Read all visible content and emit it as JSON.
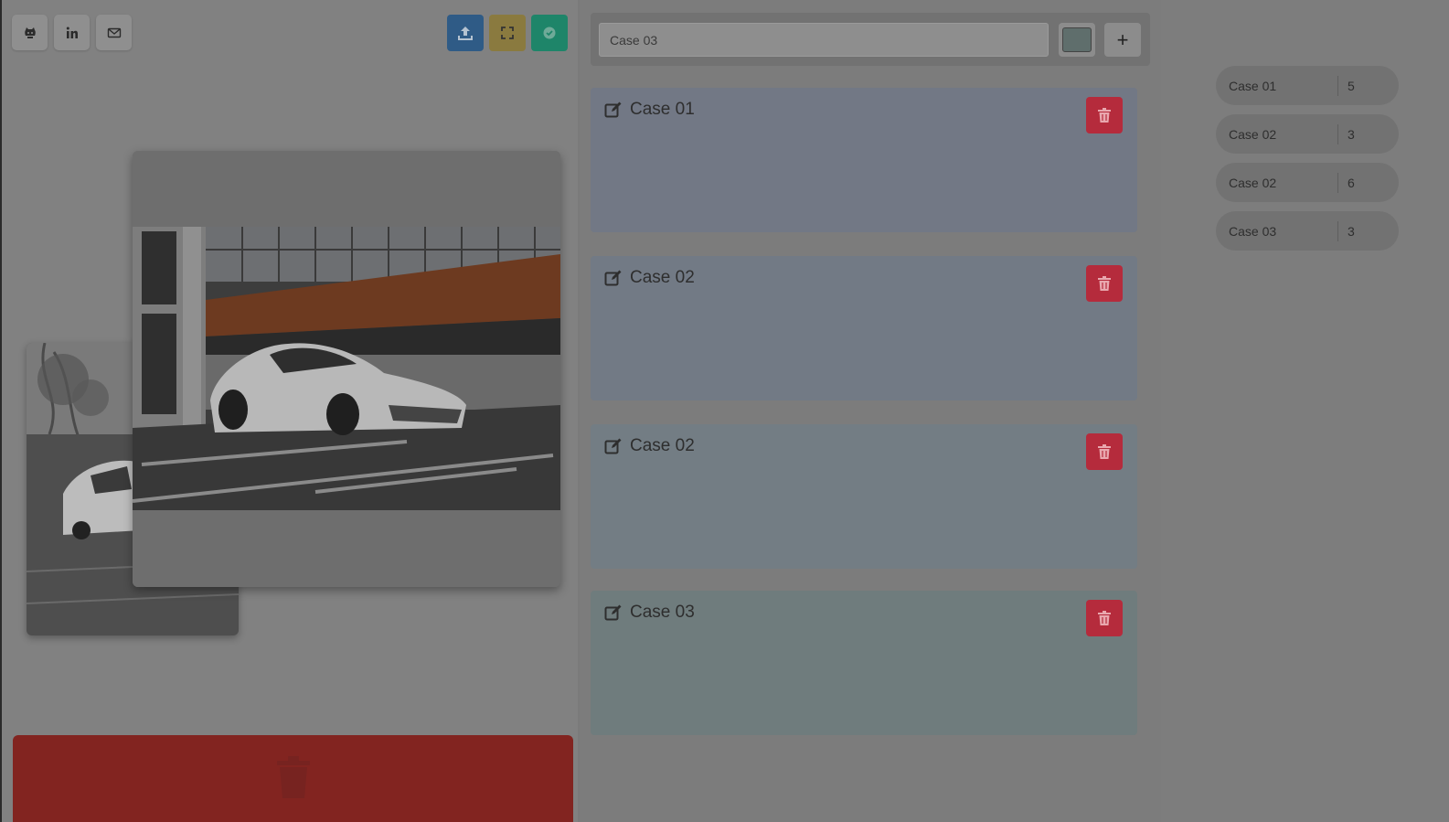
{
  "toolbar": {
    "social": [
      {
        "name": "github-icon"
      },
      {
        "name": "linkedin-icon"
      },
      {
        "name": "mail-icon"
      }
    ],
    "actions": [
      {
        "name": "upload-icon",
        "color": "#2f5b86"
      },
      {
        "name": "fullscreen-icon",
        "color": "#8a7a3f"
      },
      {
        "name": "check-icon",
        "color": "#1e8569"
      }
    ]
  },
  "editor": {
    "case_input_value": "Case 03",
    "case_input_placeholder": "",
    "swatch_color": "#5f6e6c",
    "add_label": "+"
  },
  "cases": [
    {
      "title": "Case 01",
      "color": "#727885"
    },
    {
      "title": "Case 02",
      "color": "#727a85"
    },
    {
      "title": "Case 02",
      "color": "#737d84"
    },
    {
      "title": "Case 03",
      "color": "#6f7c7d"
    }
  ],
  "summary": [
    {
      "label": "Case 01",
      "count": "5"
    },
    {
      "label": "Case 02",
      "count": "3"
    },
    {
      "label": "Case 02",
      "count": "6"
    },
    {
      "label": "Case 03",
      "count": "3"
    }
  ],
  "trash_zone": {
    "icon": "trash-icon",
    "color": "#822420"
  }
}
